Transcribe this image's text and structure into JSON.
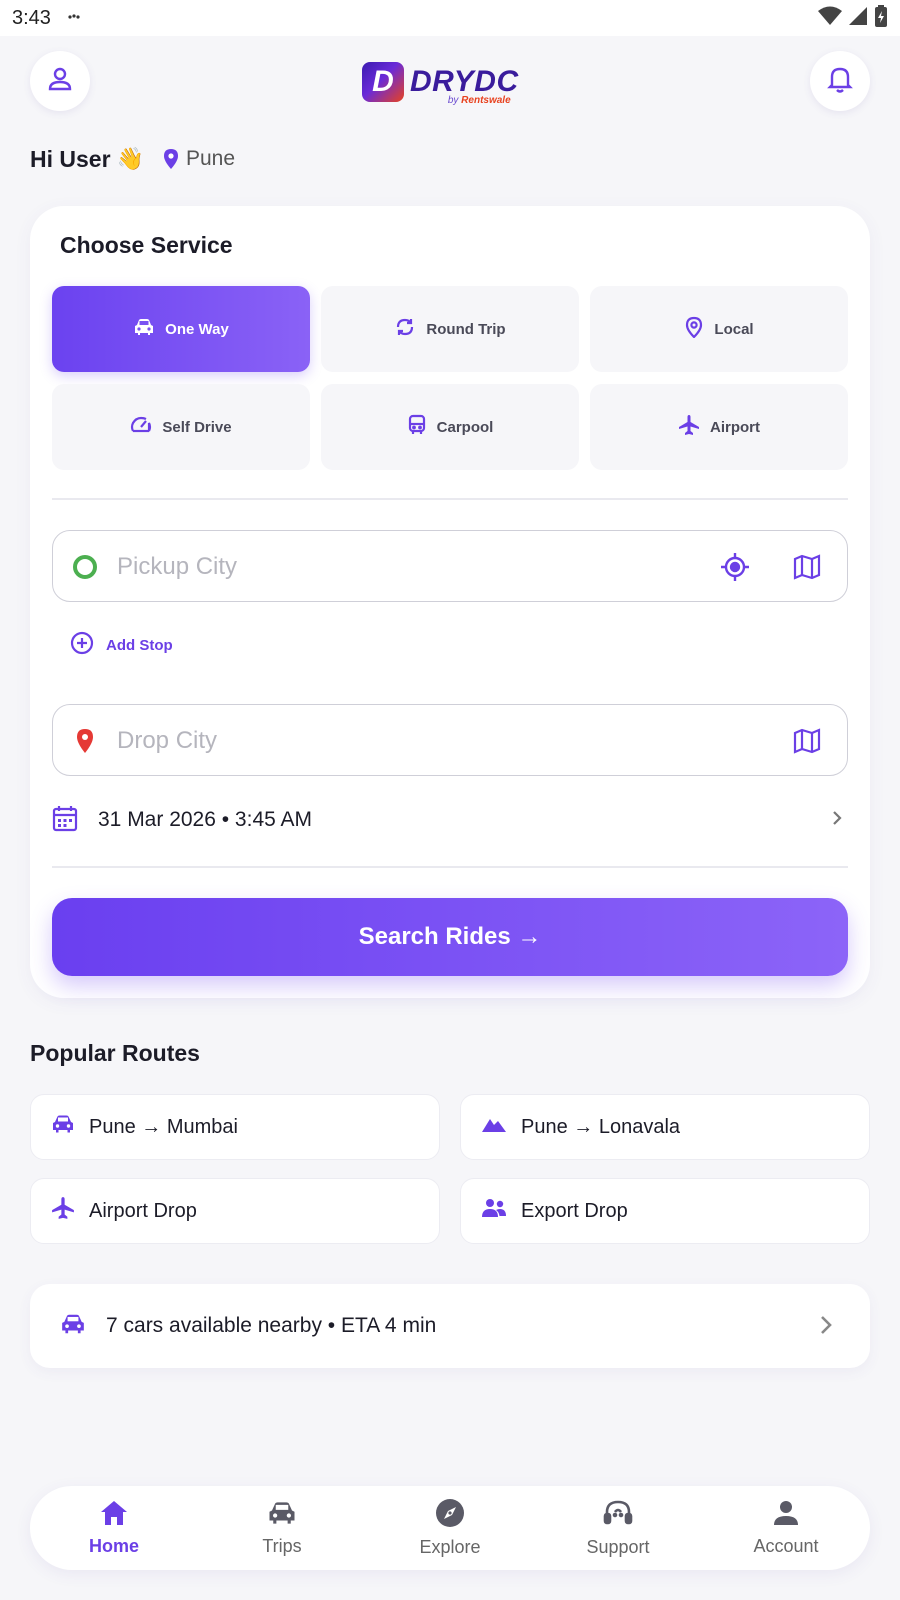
{
  "status_bar": {
    "time": "3:43"
  },
  "header": {
    "logo_word": "DRYDC",
    "logo_mark": "D",
    "logo_sub_by": "by",
    "logo_sub_brand": "Rentswale"
  },
  "greeting": {
    "text": "Hi User",
    "emoji": "👋",
    "city": "Pune"
  },
  "service_card": {
    "title": "Choose Service",
    "services": [
      {
        "label": "One Way",
        "icon": "car-icon",
        "active": true
      },
      {
        "label": "Round Trip",
        "icon": "refresh-icon",
        "active": false
      },
      {
        "label": "Local",
        "icon": "location-pin-icon",
        "active": false
      },
      {
        "label": "Self Drive",
        "icon": "speedometer-icon",
        "active": false
      },
      {
        "label": "Carpool",
        "icon": "bus-icon",
        "active": false
      },
      {
        "label": "Airport",
        "icon": "airplane-icon",
        "active": false
      }
    ],
    "pickup": {
      "placeholder": "Pickup City",
      "value": ""
    },
    "add_stop": "Add Stop",
    "drop": {
      "placeholder": "Drop City",
      "value": ""
    },
    "datetime": "31 Mar 2026 • 3:45 AM",
    "search_button": "Search Rides →"
  },
  "popular_routes": {
    "title": "Popular Routes",
    "routes": [
      {
        "label": "Pune → Mumbai",
        "icon": "car-icon"
      },
      {
        "label": "Pune → Lonavala",
        "icon": "mountain-icon"
      },
      {
        "label": "Airport Drop",
        "icon": "airplane-icon"
      },
      {
        "label": "Export Drop",
        "icon": "people-icon"
      }
    ]
  },
  "nearby": {
    "text": "7 cars available nearby • ETA 4 min"
  },
  "bottom_nav": {
    "items": [
      {
        "label": "Home",
        "icon": "home-icon",
        "active": true
      },
      {
        "label": "Trips",
        "icon": "car-icon",
        "active": false
      },
      {
        "label": "Explore",
        "icon": "compass-icon",
        "active": false
      },
      {
        "label": "Support",
        "icon": "headset-icon",
        "active": false
      },
      {
        "label": "Account",
        "icon": "person-icon",
        "active": false
      }
    ]
  },
  "colors": {
    "accent": "#6b3fe6",
    "accent_light": "#8a62f6",
    "pickup_dot": "#4caf50",
    "drop_pin": "#e53935",
    "background": "#f6f6f9"
  }
}
